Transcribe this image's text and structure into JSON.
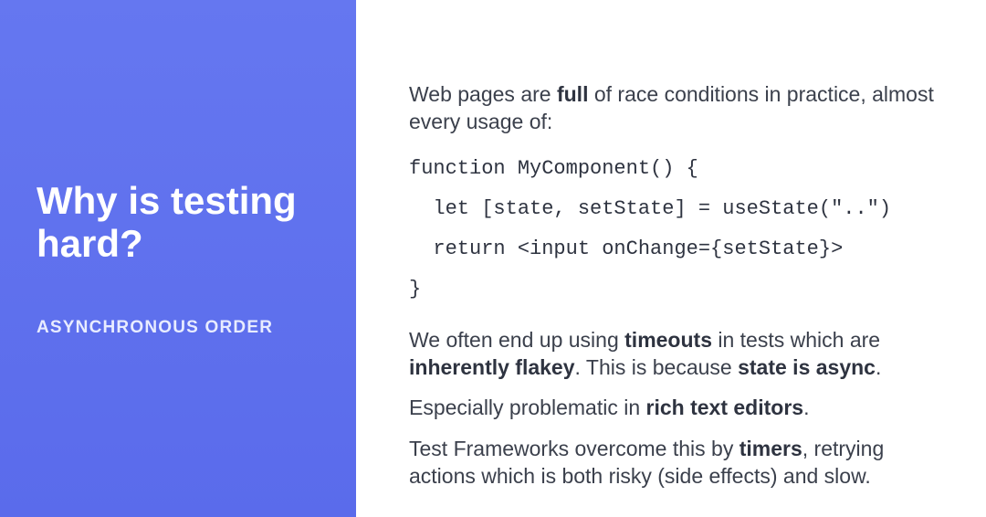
{
  "sidebar": {
    "heading": "Why is testing hard?",
    "subhead": "ASYNCHRONOUS ORDER"
  },
  "content": {
    "p1_a": "Web pages are ",
    "p1_b": "full",
    "p1_c": " of race conditions in practice, almost every usage of:",
    "code": "function MyComponent() {\n  let [state, setState] = useState(\"..\")\n  return <input onChange={setState}>\n}",
    "p2_a": "We often end up using ",
    "p2_b": "timeouts",
    "p2_c": " in tests which are ",
    "p2_d": "inherently flakey",
    "p2_e": ". This is because ",
    "p2_f": "state is async",
    "p2_g": ".",
    "p3_a": "Especially problematic in ",
    "p3_b": "rich text editors",
    "p3_c": ".",
    "p4_a": "Test Frameworks overcome this by ",
    "p4_b": "timers",
    "p4_c": ", retrying actions which is both risky (side effects) and slow."
  }
}
